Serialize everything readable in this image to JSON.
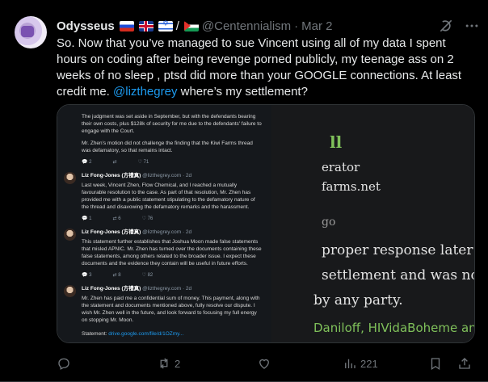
{
  "tweet": {
    "author_name": "Odysseus",
    "flags": [
      "russia-flag",
      "uk-flag",
      "israel-flag",
      "palestine-flag"
    ],
    "flag_separator": "/",
    "handle": "@Centennialism",
    "dot": "·",
    "date": "Mar 2",
    "text_part1": "So. Now that you’ve managed to sue Vincent using all of my data I spent hours on coding after being revenge porned publicly, my teenage ass on 2 weeks of no sleep , ptsd did more than your GOOGLE connections. At least credit me. ",
    "mention": "@lizthegrey",
    "text_part2": " where’s my settlement?",
    "stats": {
      "replies": "",
      "reposts": "2",
      "likes": "",
      "views": "221"
    }
  },
  "screenshot_left": {
    "intro_para1": "The judgment was set aside in September, but with the defendants bearing their own costs, plus $128k of security for me due to the defendants' failure to engage with the Court.",
    "intro_para2": "Mr. Zhen's motion did not challenge the finding that the Kiwi Farms thread was defamatory, so that remains intact.",
    "intro_stats": {
      "replies": "2",
      "reposts": "",
      "likes": "71"
    },
    "posts": [
      {
        "name": "Liz Fong-Jones (方禮真)",
        "handle": "@lizthegrey.com · 2d",
        "body": "Last week, Vincent Zhen, Flow Chemical, and I reached a mutually favourable resolution to the case. As part of that resolution, Mr. Zhen has provided me with a public statement stipulating to the defamatory nature of the thread and disavowing the defamatory remarks and the harassment.",
        "replies": "1",
        "reposts": "6",
        "likes": "76"
      },
      {
        "name": "Liz Fong-Jones (方禮真)",
        "handle": "@lizthegrey.com · 2d",
        "body": "This statement further establishes that Joshua Moon made false statements that misled APNIC. Mr. Zhen has turned over the documents containing these false statements, among others related to the broader issue. I expect these documents and the evidence they contain will be useful in future efforts.",
        "replies": "3",
        "reposts": "8",
        "likes": "82"
      },
      {
        "name": "Liz Fong-Jones (方禮真)",
        "handle": "@lizthegrey.com · 2d",
        "body": "Mr. Zhen has paid me a confidential sum of money. This payment, along with the statement and documents mentioned above, fully resolve our dispute. I wish Mr. Zhen well in the future, and look forward to focusing my full energy on stopping Mr. Moon.",
        "replies": "",
        "reposts": "",
        "likes": ""
      }
    ],
    "statement_label": "Statement:",
    "statement_link": "drive.google.com/file/d/1OZmy..."
  },
  "screenshot_right": {
    "line1": "ll",
    "line2": "erator",
    "line3": "farms.net",
    "line4": "go",
    "line5": "proper response later but I",
    "line6": "settlement and was not inf",
    "line7": "by any party.",
    "line8": "Daniloff, HIVidaBoheme and Lord"
  },
  "colors": {
    "accent": "#1d9bf0",
    "muted": "#71767b",
    "background": "#000000",
    "green_text": "#7fc05a"
  }
}
